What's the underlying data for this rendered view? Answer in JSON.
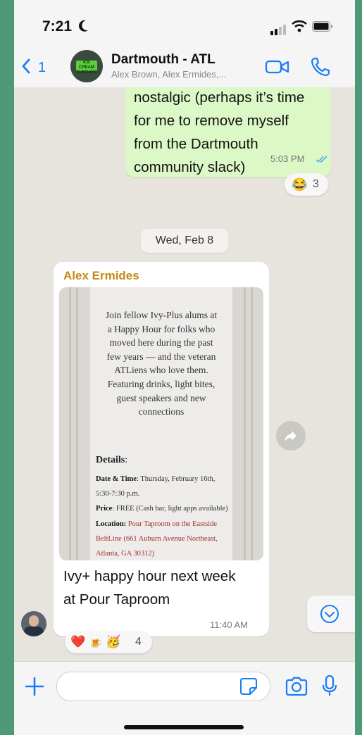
{
  "status_bar": {
    "time": "7:21"
  },
  "header": {
    "back_count": "1",
    "title": "Dartmouth - ATL",
    "subtitle": "Alex Brown, Alex Ermides,...",
    "avatar_sign_text": "ICE CREAM SUNDAES"
  },
  "messages": {
    "outgoing": {
      "text": "nostalgic (perhaps it’s time\nfor me to remove myself\nfrom the Dartmouth\ncommunity slack)",
      "time": "5:03 PM",
      "reaction_emoji": "😂",
      "reaction_count": "3"
    },
    "date_separator": "Wed, Feb 8",
    "incoming": {
      "sender": "Alex Ermides",
      "preview_blurb": "Join fellow Ivy-Plus alums at\na Happy Hour for folks who\nmoved here during the past\nfew years — and the veteran\nATLiens who love them.\nFeaturing drinks, light bites,\nguest speakers and new\nconnections",
      "details_label": "Details",
      "details_colon": ":",
      "date_label": "Date & Time",
      "date_value": ": Thursday, February 16th, 5:30-7:30 p.m.",
      "price_label": "Price",
      "price_value": ": FREE (Cash bar, light apps available)",
      "location_label": "Location:",
      "location_value": " Pour Taproom on the Eastside BeltLine (661 Auburn Avenue Northeast, Atlanta, GA 30312)",
      "text": "Ivy+ happy hour next week\nat Pour Taproom",
      "time": "11:40 AM",
      "reaction_emojis": "❤️🍺🥳",
      "reaction_count": "4"
    }
  },
  "composer": {
    "placeholder": ""
  },
  "colors": {
    "accent": "#1a7cf5",
    "outgoing_bubble": "#dcf8c6",
    "sender_name": "#c38a13",
    "chat_background": "#e7e4dd"
  },
  "icons": [
    "moon-icon",
    "signal-icon",
    "wifi-icon",
    "battery-icon",
    "back-chevron-icon",
    "video-call-icon",
    "phone-call-icon",
    "double-check-icon",
    "forward-icon",
    "scroll-down-icon",
    "plus-icon",
    "sticker-icon",
    "camera-icon",
    "microphone-icon"
  ]
}
